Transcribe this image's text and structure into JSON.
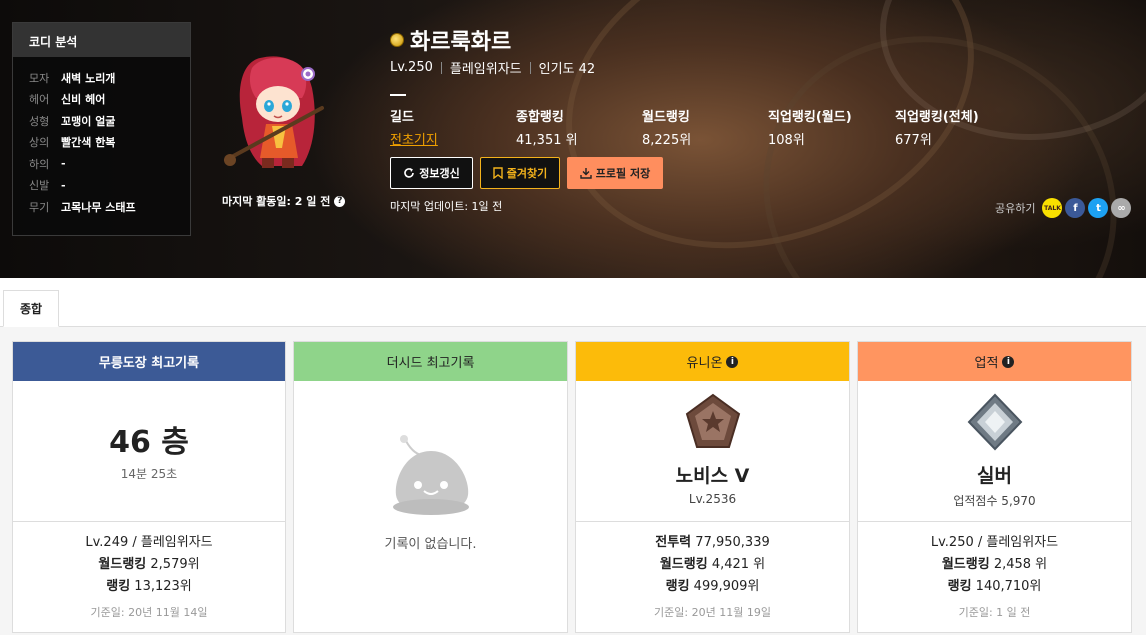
{
  "coordi": {
    "title": "코디 분석",
    "items": [
      {
        "key": "모자",
        "value": "새벽 노리개"
      },
      {
        "key": "헤어",
        "value": "신비 헤어"
      },
      {
        "key": "성형",
        "value": "꼬맹이 얼굴"
      },
      {
        "key": "상의",
        "value": "빨간색 한복"
      },
      {
        "key": "하의",
        "value": "-"
      },
      {
        "key": "신발",
        "value": "-"
      },
      {
        "key": "무기",
        "value": "고목나무 스태프"
      }
    ]
  },
  "character": {
    "last_active": "마지막 활동일: 2 일 전",
    "name": "화르룩화르",
    "level": "Lv.250",
    "job": "플레임위자드",
    "popularity": "인기도 42"
  },
  "stats": [
    {
      "label": "길드",
      "value": "전초기지"
    },
    {
      "label": "종합랭킹",
      "value": "41,351 위"
    },
    {
      "label": "월드랭킹",
      "value": "8,225위"
    },
    {
      "label": "직업랭킹(월드)",
      "value": "108위"
    },
    {
      "label": "직업랭킹(전체)",
      "value": "677위"
    }
  ],
  "buttons": {
    "refresh": "정보갱신",
    "favorite": "즐겨찾기",
    "save": "프로필 저장"
  },
  "last_update": "마지막 업데이트: 1일 전",
  "share": {
    "label": "공유하기",
    "kakao": "TALK",
    "facebook": "f",
    "twitter": "t",
    "link": "∞"
  },
  "tabs": [
    {
      "label": "종합"
    }
  ],
  "cards": {
    "dojo": {
      "title": "무릉도장 최고기록",
      "floor": "46 층",
      "time": "14분 25초",
      "line1": "Lv.249 / 플레임위자드",
      "world_rank_label": "월드랭킹",
      "world_rank": "2,579위",
      "rank_label": "랭킹",
      "rank": "13,123위",
      "date": "기준일: 20년 11월 14일"
    },
    "seed": {
      "title": "더시드 최고기록",
      "empty": "기록이 없습니다."
    },
    "union": {
      "title": "유니온",
      "grade": "노비스 V",
      "level": "Lv.2536",
      "power_label": "전투력",
      "power": "77,950,339",
      "world_rank_label": "월드랭킹",
      "world_rank": "4,421 위",
      "rank_label": "랭킹",
      "rank": "499,909위",
      "date": "기준일: 20년 11월 19일"
    },
    "achievement": {
      "title": "업적",
      "grade": "실버",
      "score": "업적점수 5,970",
      "line1": "Lv.250 / 플레임위자드",
      "world_rank_label": "월드랭킹",
      "world_rank": "2,458 위",
      "rank_label": "랭킹",
      "rank": "140,710위",
      "date": "기준일: 1 일 전"
    }
  }
}
